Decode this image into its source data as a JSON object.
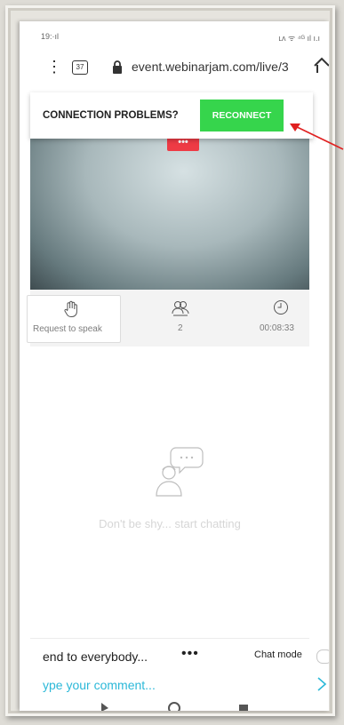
{
  "browser": {
    "status_left": "19:·ıl",
    "status_right": "ʟᴧ ᯤ ⁴ᴳ ıl ı.ı",
    "tab_count": "37",
    "url": "event.webinarjam.com/live/3"
  },
  "video": {
    "badge": "•••"
  },
  "connection": {
    "message": "CONNECTION PROBLEMS?",
    "button_label": "RECONNECT",
    "button_color": "#36d54c",
    "arrow_color": "#e02020"
  },
  "controls": {
    "request_label": "Request to speak",
    "attendees_count": "2",
    "timer": "00:08:33"
  },
  "chat": {
    "empty_message": "Don't be shy... start chatting",
    "send_to": "end to everybody...",
    "more": "•••",
    "mode_label": "Chat mode",
    "comment_placeholder": "ype your comment...",
    "accent_color": "#2bb8d8"
  }
}
